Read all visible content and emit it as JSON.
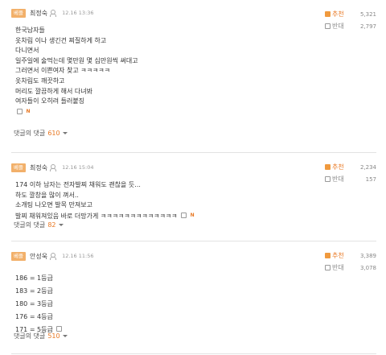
{
  "best_badge": "베플",
  "up_label": "추천",
  "down_label": "반대",
  "replies_label": "댓글의 댓글",
  "comments": [
    {
      "author": "최정숙",
      "time": "12.16 13:36",
      "lines": [
        "한국남자들",
        "옷차림 이나 생긴건 찌질하게 하고",
        "다니면서",
        "일주일에 술먹는데 몇만원 몇 십만원씩 써대고",
        "그러면서 이쁜여자 찾고 ㅋㅋㅋㅋㅋ",
        "옷차림도 깨끗하고",
        "머리도 깔끔하게 해서 다녀봐",
        "여자들이 오히려 들러붙징"
      ],
      "up": "5,321",
      "down": "2,797",
      "replies": "610"
    },
    {
      "author": "최정숙",
      "time": "12.16 15:04",
      "lines": [
        "174 이하 남자는 전자발찌 채워도 괜찮을 듯...",
        "하도 깔창을 많이 껴서..",
        "소개팅 나오면 발목 만져보고",
        "발찌 채워져있음 바로 더망가게 ㅋㅋㅋㅋㅋㅋㅋㅋㅋㅋㅋㅋㅋ"
      ],
      "up": "2,234",
      "down": "157",
      "replies": "82"
    },
    {
      "author": "안성욱",
      "time": "12.16 11:56",
      "lines": [
        "186 = 1등급",
        "183 = 2등급",
        "180 = 3등급",
        "176 = 4등급",
        "171 = 5등급"
      ],
      "up": "3,389",
      "down": "3,078",
      "replies": "510"
    }
  ],
  "icons": {
    "up": "thumbs-up-icon",
    "down": "thumbs-down-icon",
    "user": "user-icon",
    "lock": "lock-icon",
    "new": "new-badge-icon",
    "caret": "caret-down-icon"
  },
  "colors": {
    "accent": "#e87722",
    "badge": "#f2b06a"
  },
  "new_badge": "N"
}
